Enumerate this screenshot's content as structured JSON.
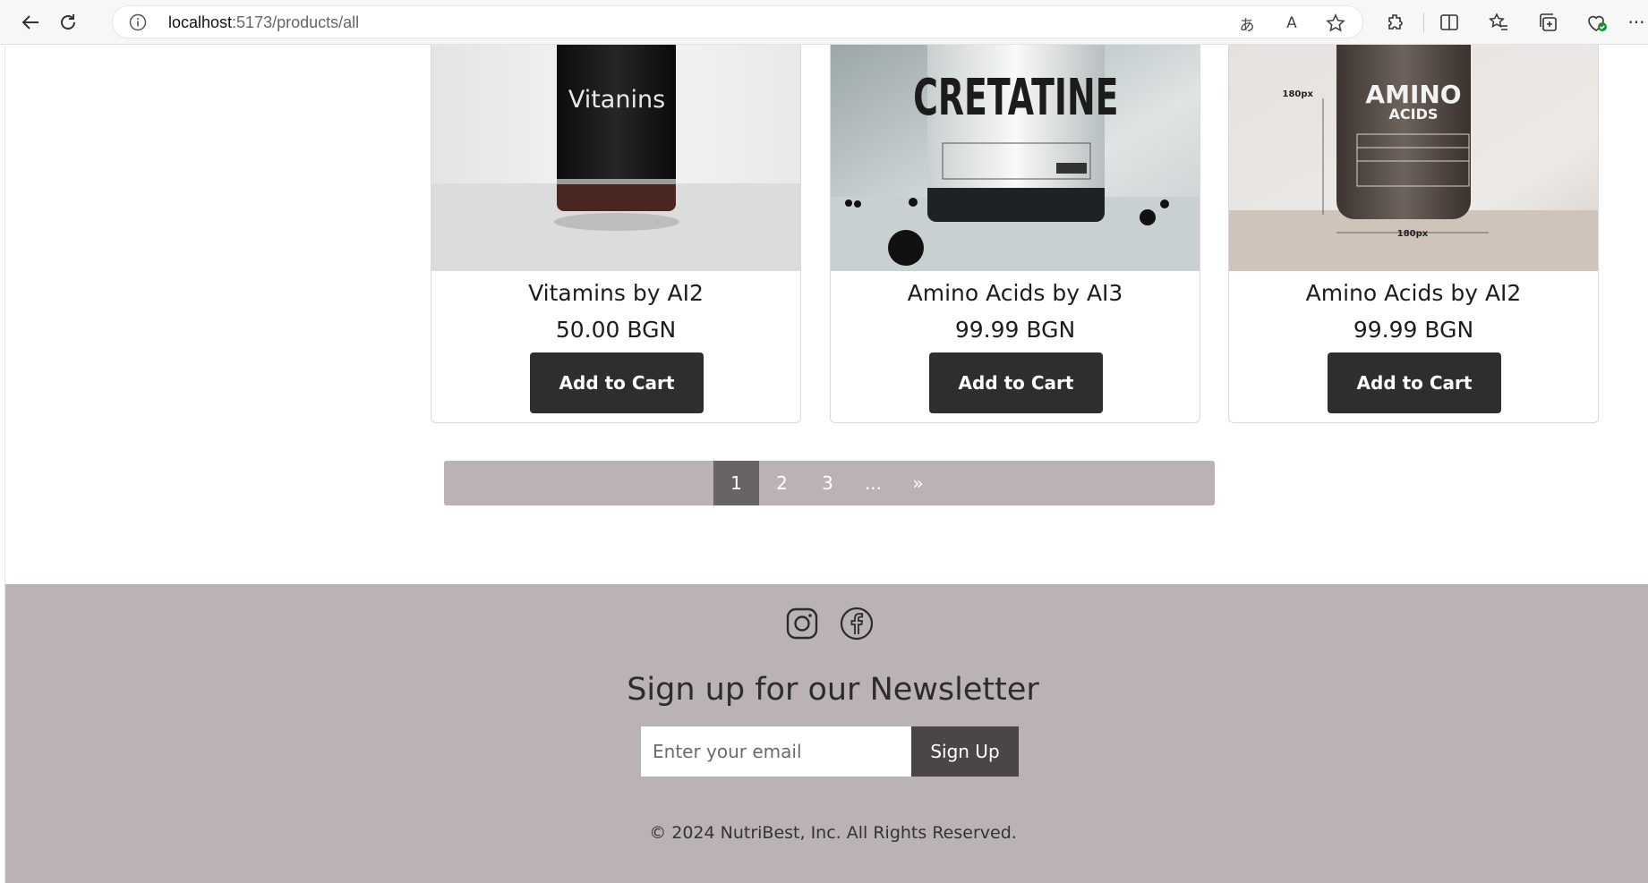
{
  "browser": {
    "url_host": "localhost",
    "url_path": ":5173/products/all"
  },
  "products": [
    {
      "name": "Vitamins by AI2",
      "price": "50.00 BGN",
      "button_label": "Add to Cart",
      "image_text": "Vitanins"
    },
    {
      "name": "Amino Acids by AI3",
      "price": "99.99 BGN",
      "button_label": "Add to Cart",
      "image_text": "CRETATINE"
    },
    {
      "name": "Amino Acids by AI2",
      "price": "99.99 BGN",
      "button_label": "Add to Cart",
      "image_text": "AMINO",
      "image_text_2": "ACIDS",
      "image_dim_label": "180px"
    }
  ],
  "pagination": {
    "pages": [
      "1",
      "2",
      "3",
      "...",
      "»"
    ],
    "active": "1"
  },
  "footer": {
    "social_icons": [
      "instagram-icon",
      "facebook-icon"
    ],
    "newsletter_title": "Sign up for our Newsletter",
    "email_placeholder": "Enter your email",
    "signup_label": "Sign Up",
    "copyright": "© 2024 NutriBest, Inc. All Rights Reserved."
  },
  "colors": {
    "button_dark": "#2e2e2e",
    "footer_bg": "#bbb2b3",
    "pagination_active": "#696464",
    "signup_button": "#4a4646"
  }
}
